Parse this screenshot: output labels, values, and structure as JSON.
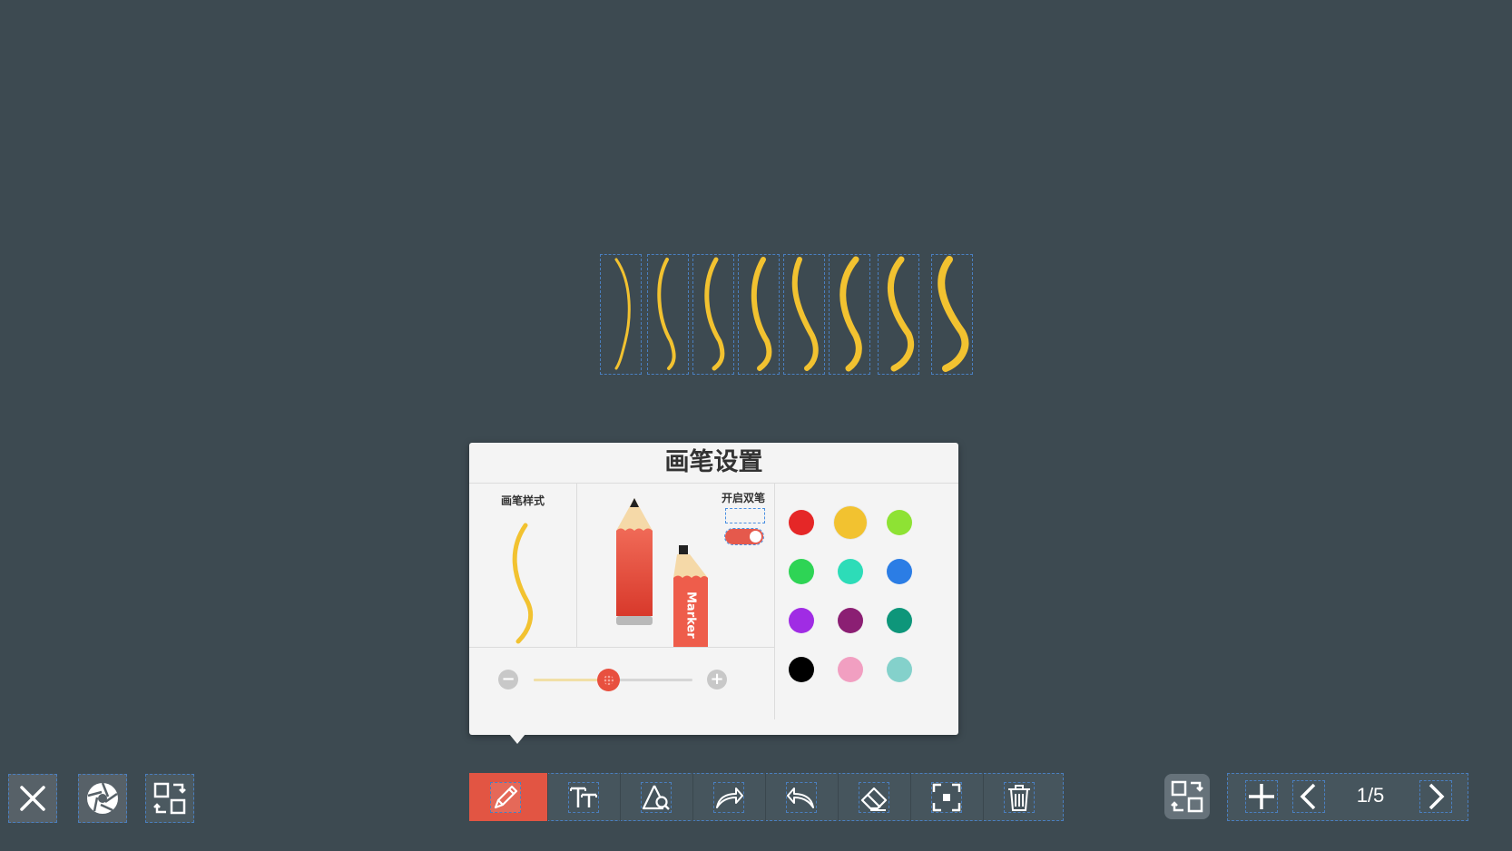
{
  "popup": {
    "title": "画笔设置",
    "brush_style_label": "画笔样式",
    "dual_pen_label": "开启双笔",
    "dual_pen_enabled": true,
    "marker_label": "Marker",
    "size_level": 0.47,
    "selected_color": "#f2c230",
    "colors": [
      "#e52727",
      "#f2c230",
      "#8ee234",
      "#2ed455",
      "#2ddcb8",
      "#2b7de5",
      "#a02ce4",
      "#8b1f73",
      "#0e967a",
      "#000000",
      "#f19fc1",
      "#84d1cb"
    ]
  },
  "brush_preview_color": "#f2c230",
  "brush_samples": [
    "brush-width-1",
    "brush-width-2",
    "brush-width-3",
    "brush-width-4",
    "brush-width-5",
    "brush-width-6",
    "brush-width-7",
    "brush-width-8"
  ],
  "left_buttons": [
    "close-icon",
    "aperture-icon",
    "switch-layout-icon"
  ],
  "toolbar": {
    "tools": [
      "pen-icon",
      "text-icon",
      "shape-icon",
      "redo-icon",
      "undo-icon",
      "eraser-icon",
      "fullscreen-icon",
      "trash-icon"
    ],
    "active_tool": "pen-icon",
    "accent_color": "#e25543"
  },
  "pager": {
    "page_label": "1/5"
  }
}
